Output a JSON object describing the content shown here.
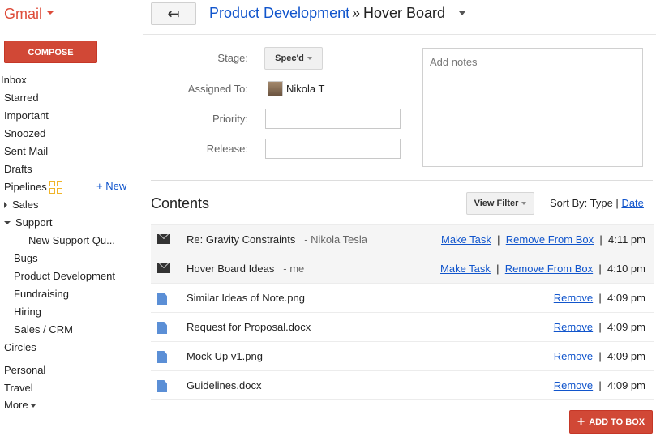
{
  "app": {
    "name": "Gmail",
    "compose_label": "COMPOSE"
  },
  "nav": {
    "inbox": "Inbox",
    "starred": "Starred",
    "important": "Important",
    "snoozed": "Snoozed",
    "sent": "Sent Mail",
    "drafts": "Drafts",
    "pipelines": "Pipelines",
    "new_link": "+ New",
    "sales": "Sales",
    "support": "Support",
    "new_support": "New Support Qu...",
    "bugs": "Bugs",
    "product_dev": "Product Development",
    "fundraising": "Fundraising",
    "hiring": "Hiring",
    "sales_crm": "Sales / CRM",
    "circles": "Circles",
    "personal": "Personal",
    "travel": "Travel",
    "more": "More"
  },
  "header": {
    "back_icon": "↤",
    "pipeline_link": "Product Development",
    "separator": "»",
    "box_title": "Hover Board"
  },
  "fields": {
    "stage_label": "Stage:",
    "stage_value": "Spec'd",
    "assigned_label": "Assigned To:",
    "assigned_value": "Nikola T",
    "priority_label": "Priority:",
    "priority_value": "",
    "release_label": "Release:",
    "release_value": "",
    "notes_placeholder": "Add notes"
  },
  "contents": {
    "title": "Contents",
    "view_filter": "View Filter",
    "sort_by_label": "Sort By: Type",
    "sort_sep": "|",
    "sort_date": "Date",
    "rows": [
      {
        "type": "email",
        "icon": "envelope-icon",
        "subject": "Re: Gravity Constraints",
        "sender": "-  Nikola Tesla",
        "action1": "Make Task",
        "action2": "Remove From Box",
        "sep": "|",
        "time": "4:11 pm"
      },
      {
        "type": "email",
        "icon": "envelope-icon",
        "subject": "Hover Board Ideas",
        "sender": "-  me",
        "action1": "Make Task",
        "action2": "Remove From Box",
        "sep": "|",
        "time": "4:10 pm"
      },
      {
        "type": "file",
        "icon": "file-icon",
        "subject": "Similar Ideas of Note.png",
        "action": "Remove",
        "sep": "|",
        "time": "4:09 pm"
      },
      {
        "type": "file",
        "icon": "file-icon",
        "subject": "Request for Proposal.docx",
        "action": "Remove",
        "sep": "|",
        "time": "4:09 pm"
      },
      {
        "type": "file",
        "icon": "file-icon",
        "subject": "Mock Up v1.png",
        "action": "Remove",
        "sep": "|",
        "time": "4:09 pm"
      },
      {
        "type": "file",
        "icon": "file-icon",
        "subject": "Guidelines.docx",
        "action": "Remove",
        "sep": "|",
        "time": "4:09 pm"
      }
    ],
    "add_to_box": "ADD TO BOX"
  },
  "colors": {
    "accent_red": "#d14836",
    "link_blue": "#1155cc",
    "pipeline_icon": "#f0b429"
  }
}
